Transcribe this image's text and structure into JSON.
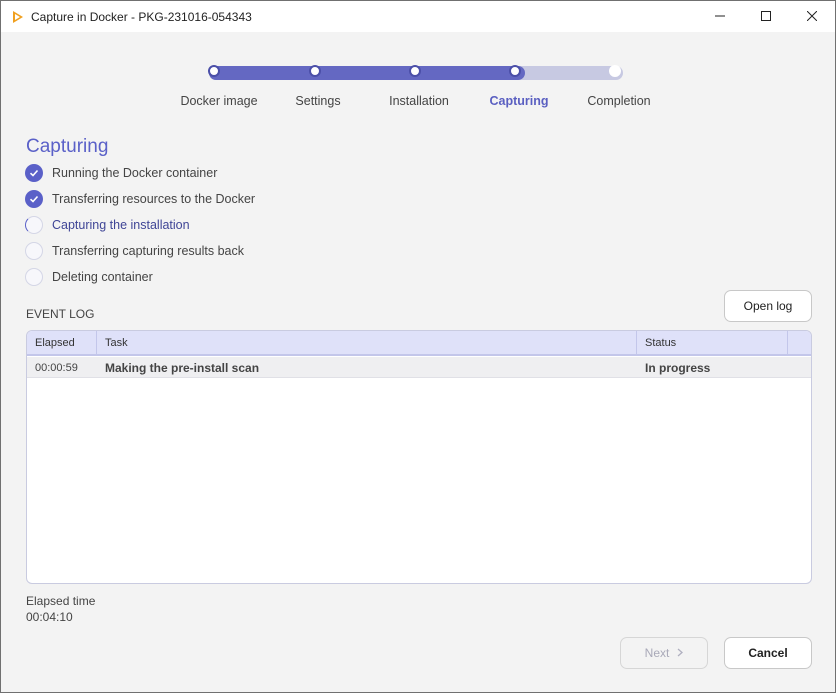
{
  "window": {
    "title": "Capture in Docker - PKG-231016-054343",
    "accent_color": "#5a60c8",
    "icons": {
      "app": "app-logo-icon",
      "minimize": "minimize-icon",
      "maximize": "maximize-icon",
      "close": "close-icon"
    }
  },
  "stepper": {
    "steps": [
      {
        "label": "Docker image",
        "state": "done"
      },
      {
        "label": "Settings",
        "state": "done"
      },
      {
        "label": "Installation",
        "state": "done"
      },
      {
        "label": "Capturing",
        "state": "active"
      },
      {
        "label": "Completion",
        "state": "future"
      }
    ]
  },
  "section": {
    "title": "Capturing",
    "tasks": [
      {
        "label": "Running the Docker container",
        "state": "done"
      },
      {
        "label": "Transferring resources to the Docker",
        "state": "done"
      },
      {
        "label": "Capturing the installation",
        "state": "current"
      },
      {
        "label": "Transferring capturing results back",
        "state": "pending"
      },
      {
        "label": "Deleting container",
        "state": "pending"
      }
    ]
  },
  "event_log": {
    "label": "EVENT LOG",
    "open_log_label": "Open log",
    "columns": [
      "Elapsed",
      "Task",
      "Status"
    ],
    "rows": [
      {
        "elapsed": "00:00:59",
        "task": "Making the pre-install scan",
        "status": "In progress"
      }
    ]
  },
  "footer": {
    "elapsed_label": "Elapsed time",
    "elapsed_value": "00:04:10",
    "next_label": "Next",
    "cancel_label": "Cancel"
  }
}
